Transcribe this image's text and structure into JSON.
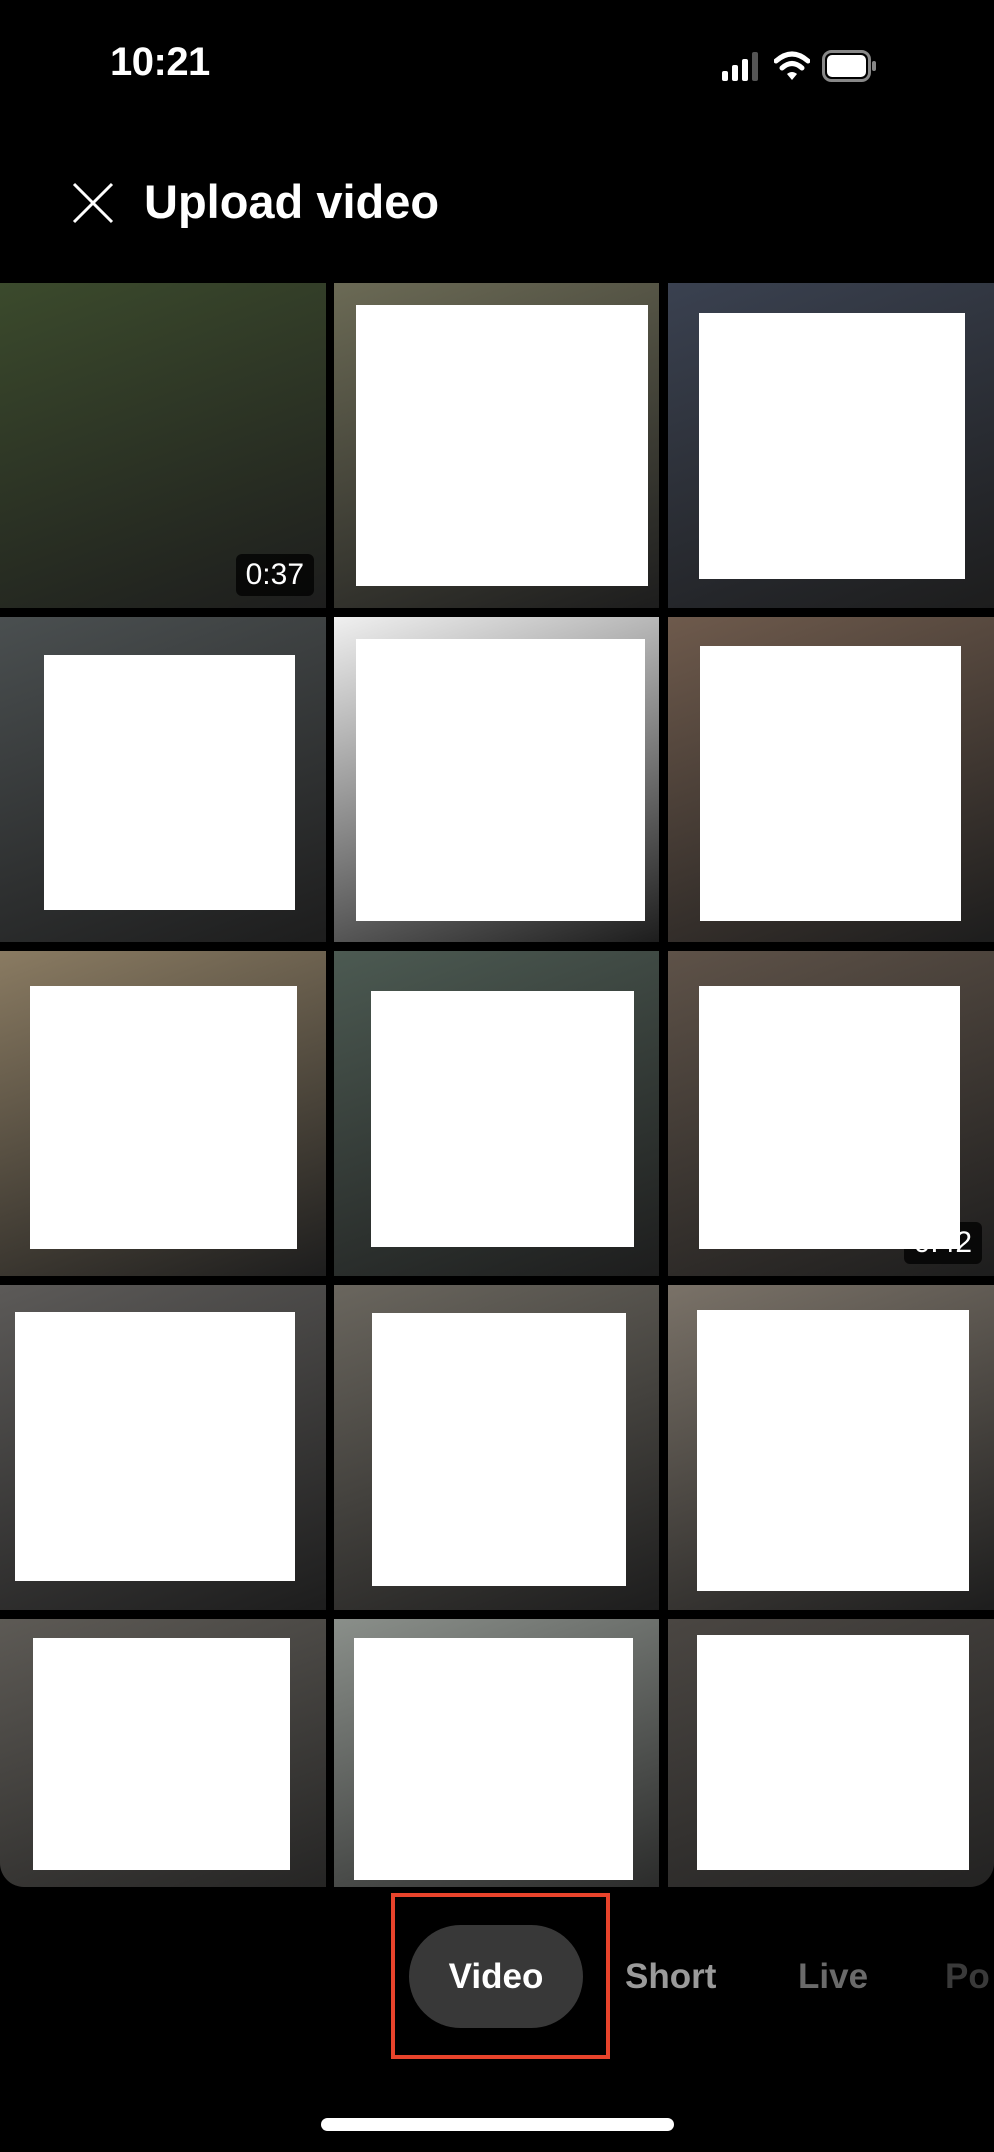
{
  "status_bar": {
    "time": "10:21",
    "icons": [
      "cellular-signal-icon",
      "wifi-icon",
      "battery-icon"
    ]
  },
  "header": {
    "title": "Upload video",
    "close_icon": "close-icon"
  },
  "grid": {
    "thumbnails": [
      {
        "duration": "0:37",
        "bg": "#3b4a2c",
        "redacted": false
      },
      {
        "duration": "",
        "bg": "#6b6a55",
        "redacted": true
      },
      {
        "duration": "",
        "bg": "#3a4150",
        "redacted": true
      },
      {
        "duration": "",
        "bg": "#4a4f50",
        "redacted": true
      },
      {
        "duration": "",
        "bg": "#f0f0f0",
        "redacted": true
      },
      {
        "duration": "",
        "bg": "#6e5a4c",
        "redacted": true
      },
      {
        "duration": "",
        "bg": "#8a7b62",
        "redacted": true
      },
      {
        "duration": "",
        "bg": "#4c5a52",
        "redacted": true
      },
      {
        "duration": "0:42",
        "bg": "#5e5248",
        "redacted": true
      },
      {
        "duration": "",
        "bg": "#5c5a58",
        "redacted": true
      },
      {
        "duration": "",
        "bg": "#6a665e",
        "redacted": true
      },
      {
        "duration": "",
        "bg": "#7a7268",
        "redacted": true
      },
      {
        "duration": "",
        "bg": "#5d5a55",
        "redacted": true
      },
      {
        "duration": "",
        "bg": "#8a8f8a",
        "redacted": true
      },
      {
        "duration": "",
        "bg": "#4a4642",
        "redacted": true
      }
    ]
  },
  "tabs": [
    {
      "label": "Video",
      "selected": true
    },
    {
      "label": "Short",
      "selected": false
    },
    {
      "label": "Live",
      "selected": false
    },
    {
      "label": "Po",
      "selected": false
    }
  ],
  "colors": {
    "highlight": "#e8432b",
    "selected_tab_bg": "#383838"
  }
}
